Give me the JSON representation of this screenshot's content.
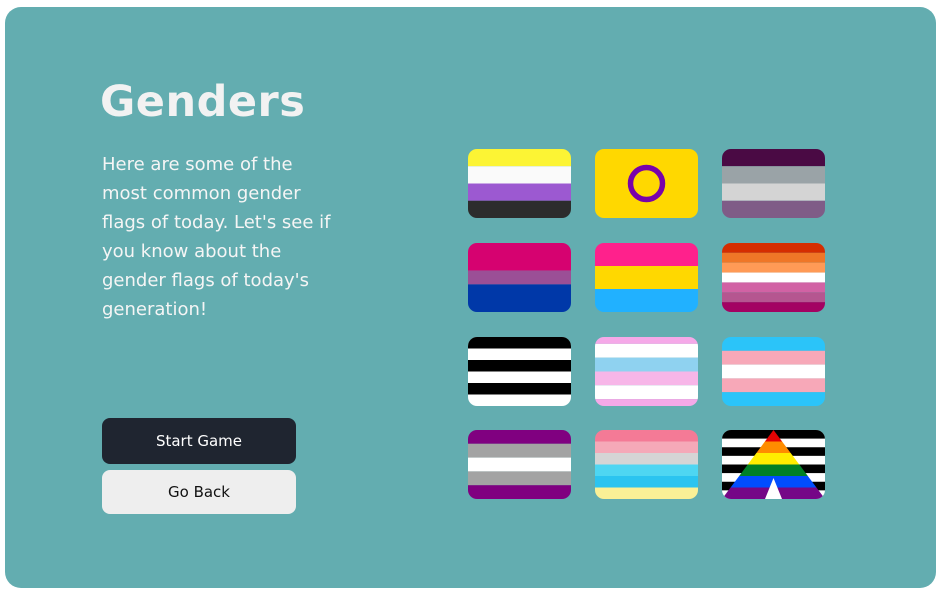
{
  "page": {
    "title": "Genders",
    "description": "Here are some of the most common gender flags of today. Let's see if you know about the gender flags of today's generation!"
  },
  "buttons": {
    "start_label": "Start Game",
    "back_label": "Go Back"
  },
  "colors": {
    "background": "#63adb0",
    "title": "#f2f2f2",
    "start_button": "#1f2530",
    "back_button": "#eeeeee"
  },
  "flags": [
    {
      "icon": "nonbinary-flag-icon"
    },
    {
      "icon": "intersex-flag-icon"
    },
    {
      "icon": "demigirl-flag-icon"
    },
    {
      "icon": "bisexual-flag-icon"
    },
    {
      "icon": "pansexual-flag-icon"
    },
    {
      "icon": "lesbian-flag-icon"
    },
    {
      "icon": "heterosexual-flag-icon"
    },
    {
      "icon": "transfeminine-flag-icon"
    },
    {
      "icon": "transgender-flag-icon"
    },
    {
      "icon": "asexual-flag-icon"
    },
    {
      "icon": "genderfluid-flag-icon"
    },
    {
      "icon": "straight-ally-flag-icon"
    }
  ]
}
